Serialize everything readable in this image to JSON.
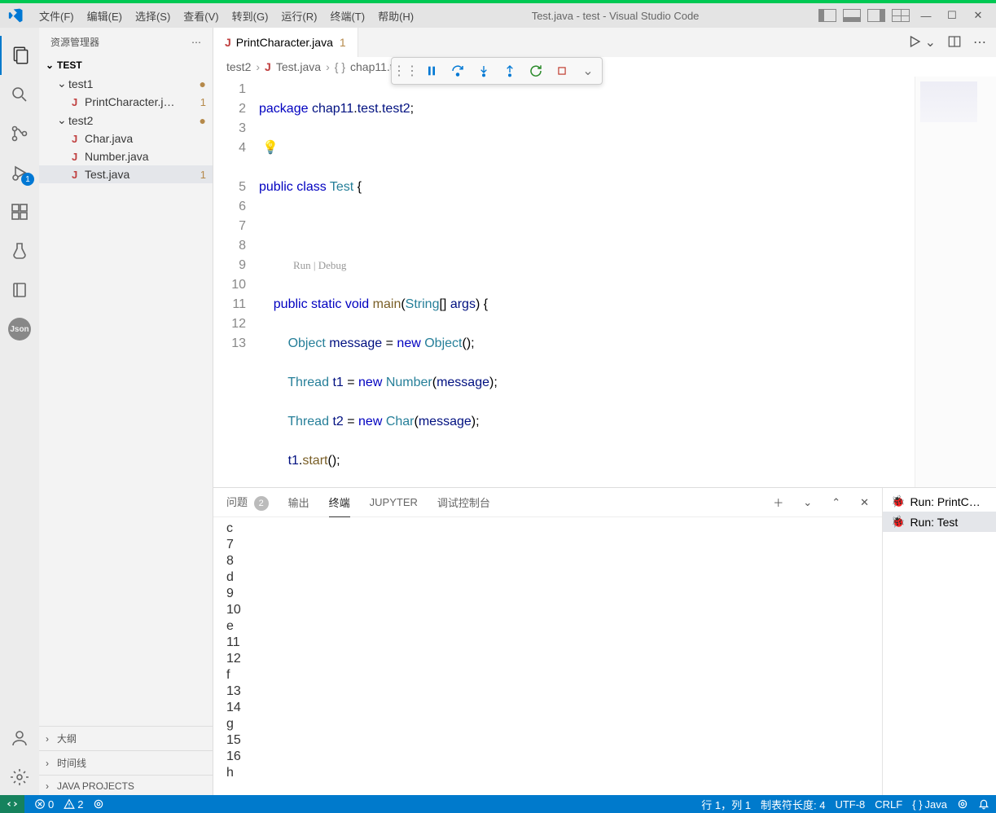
{
  "title": "Test.java - test - Visual Studio Code",
  "menu": [
    "文件(F)",
    "编辑(E)",
    "选择(S)",
    "查看(V)",
    "转到(G)",
    "运行(R)",
    "终端(T)",
    "帮助(H)"
  ],
  "activity": {
    "debug_badge": "1"
  },
  "explorer": {
    "title": "资源管理器",
    "root": "TEST",
    "folders": [
      {
        "name": "test1",
        "files": [
          {
            "name": "PrintCharacter.j…",
            "modified": "1"
          }
        ],
        "dirty": true
      },
      {
        "name": "test2",
        "files": [
          {
            "name": "Char.java"
          },
          {
            "name": "Number.java"
          },
          {
            "name": "Test.java",
            "modified": "1",
            "active": true
          }
        ],
        "dirty": true
      }
    ],
    "collapsed": [
      "大纲",
      "时间线",
      "JAVA PROJECTS"
    ]
  },
  "tab": {
    "name": "PrintCharacter.java",
    "modified": "1"
  },
  "breadcrumb": {
    "a": "test2",
    "b": "Test.java",
    "c": "chap11.test.test2"
  },
  "codelens": "Run | Debug",
  "code_lines": 13,
  "panel": {
    "tabs": {
      "problems": "问题",
      "problems_badge": "2",
      "output": "输出",
      "terminal": "终端",
      "jupyter": "JUPYTER",
      "debug": "调试控制台"
    },
    "terminal_output": [
      "c",
      "7",
      "8",
      "d",
      "9",
      "10",
      "e",
      "11",
      "12",
      "f",
      "13",
      "14",
      "g",
      "15",
      "16",
      "h"
    ],
    "runs": [
      {
        "label": "Run: PrintC…"
      },
      {
        "label": "Run: Test",
        "active": true
      }
    ]
  },
  "status": {
    "errors": "0",
    "warnings": "2",
    "ln": "行 1，列 1",
    "tab": "制表符长度: 4",
    "enc": "UTF-8",
    "eol": "CRLF",
    "lang": "Java"
  }
}
